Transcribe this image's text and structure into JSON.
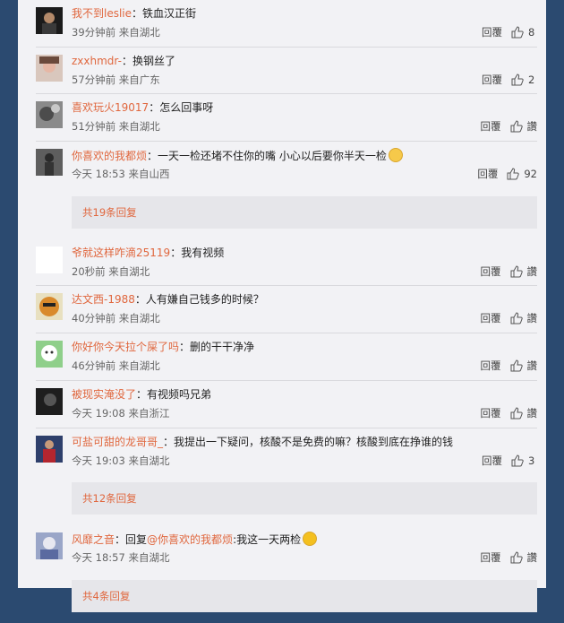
{
  "ui": {
    "reply_label": "回覆",
    "likes_placeholder": "讚"
  },
  "comments": [
    {
      "user": "我不到leslie",
      "text": "铁血汉正街",
      "meta": "39分钟前 来自湖北",
      "likes": "8"
    },
    {
      "user": "zxxhmdr-",
      "text": "换钢丝了",
      "meta": "57分钟前 来自广东",
      "likes": "2"
    },
    {
      "user": "喜欢玩火19017",
      "text": "怎么回事呀",
      "meta": "51分钟前 来自湖北",
      "likes": "讚"
    },
    {
      "user": "你喜欢的我都烦",
      "text": "一天一检还堵不住你的嘴 小心以后要你半天一检",
      "meta": "今天 18:53 来自山西",
      "likes": "92"
    },
    {
      "user": "爷就这样咋滴25119",
      "text": "我有视频",
      "meta": "20秒前 来自湖北",
      "likes": "讚"
    },
    {
      "user": "达文西-1988",
      "text": "人有嫌自己钱多的时候？",
      "meta": "40分钟前 来自湖北",
      "likes": "讚"
    },
    {
      "user": "你好你今天拉个屎了吗",
      "text": "删的干干净净",
      "meta": "46分钟前 来自湖北",
      "likes": "讚"
    },
    {
      "user": "被现实淹没了",
      "text": "有视频吗兄弟",
      "meta": "今天 19:08 来自浙江",
      "likes": "讚"
    },
    {
      "user": "可盐可甜的龙哥哥_",
      "text": "我提出一下疑问，核酸不是免费的嘛？核酸到底在挣谁的钱",
      "meta": "今天 19:03 来自湖北",
      "likes": "3"
    },
    {
      "user": "风靡之音",
      "reply_prefix": "回复",
      "mention": "@你喜欢的我都烦",
      "text": ":我这一天两检",
      "meta": "今天 18:57 来自湖北",
      "likes": "讚"
    }
  ],
  "more_links": {
    "a": "共19条回复",
    "b": "共12条回复",
    "c": "共4条回复"
  }
}
